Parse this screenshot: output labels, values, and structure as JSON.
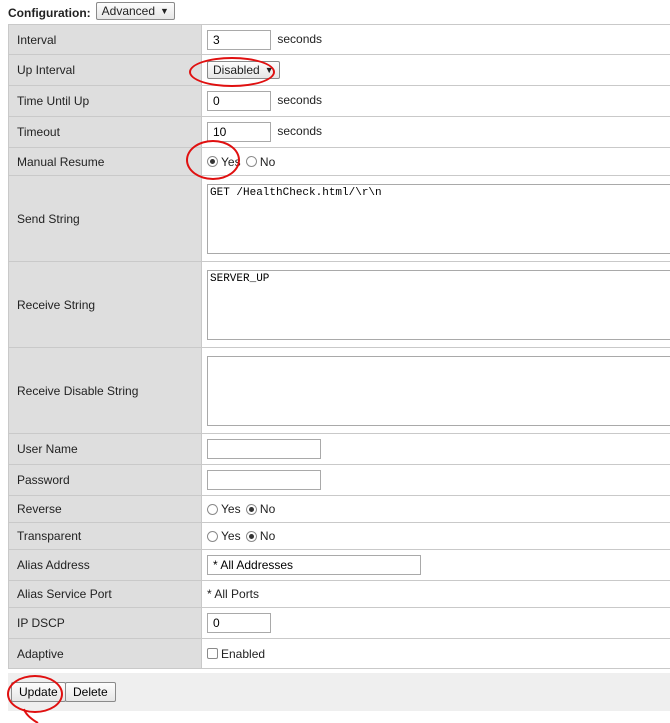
{
  "config": {
    "label": "Configuration:",
    "mode": "Advanced"
  },
  "rows": {
    "interval": {
      "label": "Interval",
      "value": "3",
      "unit": "seconds"
    },
    "up_interval": {
      "label": "Up Interval",
      "selected": "Disabled"
    },
    "time_until_up": {
      "label": "Time Until Up",
      "value": "0",
      "unit": "seconds"
    },
    "timeout": {
      "label": "Timeout",
      "value": "10",
      "unit": "seconds"
    },
    "manual_resume": {
      "label": "Manual Resume",
      "yes": "Yes",
      "no": "No",
      "selected": "Yes"
    },
    "send_string": {
      "label": "Send String",
      "value": "GET /HealthCheck.html/\\r\\n"
    },
    "receive_string": {
      "label": "Receive String",
      "value": "SERVER_UP"
    },
    "receive_disable_string": {
      "label": "Receive Disable String",
      "value": ""
    },
    "user_name": {
      "label": "User Name",
      "value": ""
    },
    "password": {
      "label": "Password",
      "value": ""
    },
    "reverse": {
      "label": "Reverse",
      "yes": "Yes",
      "no": "No",
      "selected": "No"
    },
    "transparent": {
      "label": "Transparent",
      "yes": "Yes",
      "no": "No",
      "selected": "No"
    },
    "alias_address": {
      "label": "Alias Address",
      "value": "* All Addresses"
    },
    "alias_service_port": {
      "label": "Alias Service Port",
      "value": "* All Ports"
    },
    "ip_dscp": {
      "label": "IP DSCP",
      "value": "0"
    },
    "adaptive": {
      "label": "Adaptive",
      "checkbox_label": "Enabled",
      "checked": false
    }
  },
  "buttons": {
    "update": "Update",
    "delete": "Delete"
  },
  "colors": {
    "annotation": "#e01010",
    "label_bg": "#dedede",
    "button_bar_bg": "#efefef"
  }
}
